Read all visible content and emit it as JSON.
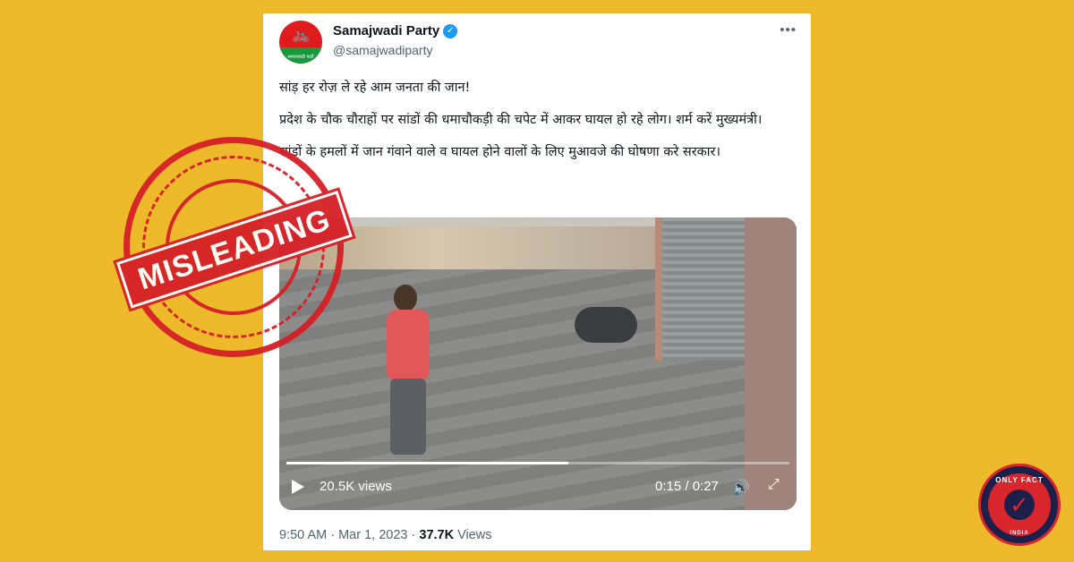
{
  "tweet": {
    "author_name": "Samajwadi Party",
    "author_handle": "@samajwadiparty",
    "avatar_caption": "समाजवादी पार्टी",
    "paragraphs": [
      "सांड़ हर रोज़ ले रहे आम जनता की जान!",
      "प्रदेश के चौक चौराहों पर सांडों की धमाचौकड़ी की चपेट में आकर घायल हो रहे लोग। शर्म करें मुख्यमंत्री।",
      "सांडों के हमलों में जान गंवाने वाले व घायल होने वालों के लिए मुआवजे की घोषणा करे सरकार।"
    ],
    "video": {
      "views": "20.5K views",
      "time": "0:15 / 0:27",
      "progress_fraction": 0.56
    },
    "time_posted": "9:50 AM",
    "date_posted": "Mar 1, 2023",
    "view_count": "37.7K",
    "views_label": "Views"
  },
  "stamp": {
    "label": "MISLEADING"
  },
  "logo": {
    "top_text": "ONLY FACT",
    "bottom_text": "INDIA"
  },
  "colors": {
    "background": "#efb92c",
    "stamp": "#d61f26",
    "verified": "#1d9bf0"
  }
}
